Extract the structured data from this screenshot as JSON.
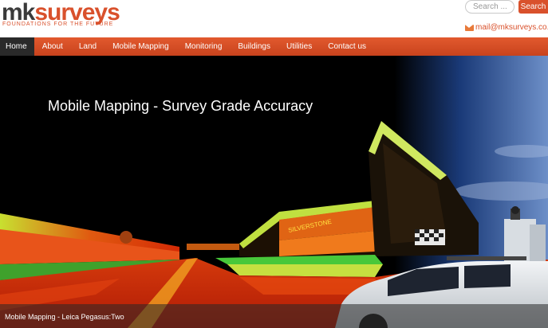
{
  "logo": {
    "mk": "mk",
    "surveys": "surveys",
    "tagline": "FOUNDATIONS FOR THE FUTURE"
  },
  "search": {
    "placeholder": "Search ...",
    "button_label": "Search"
  },
  "contact": {
    "email": "mail@mksurveys.co.uk"
  },
  "nav": {
    "items": [
      {
        "label": "Home"
      },
      {
        "label": "About"
      },
      {
        "label": "Land"
      },
      {
        "label": "Mobile Mapping"
      },
      {
        "label": "Monitoring"
      },
      {
        "label": "Buildings"
      },
      {
        "label": "Utilities"
      },
      {
        "label": "Contact us"
      }
    ],
    "active": "Home"
  },
  "hero": {
    "title": "Mobile Mapping - Survey Grade Accuracy",
    "sign_text": "SILVERSTONE",
    "caption": "Mobile Mapping - Leica Pegasus:Two"
  },
  "colors": {
    "accent": "#d9512c",
    "nav_active": "#2a2a2a"
  },
  "icons": {
    "mail": "envelope-icon"
  }
}
